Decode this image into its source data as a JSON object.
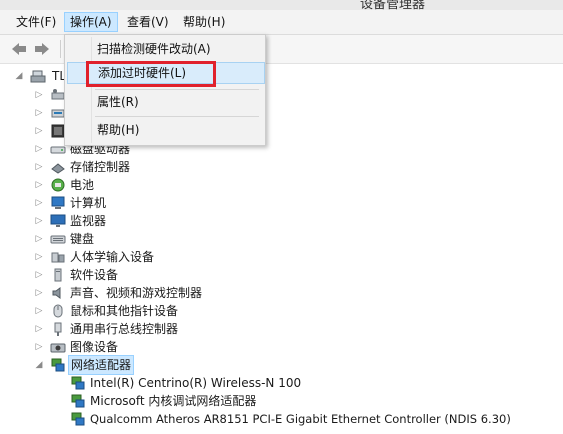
{
  "window": {
    "title": "设备管理器"
  },
  "menubar": {
    "items": [
      {
        "label": "文件(F)"
      },
      {
        "label": "操作(A)"
      },
      {
        "label": "查看(V)"
      },
      {
        "label": "帮助(H)"
      }
    ]
  },
  "toolbar": {
    "back_icon": "back-arrow-icon",
    "forward_icon": "forward-arrow-icon"
  },
  "action_menu": {
    "items": [
      {
        "label": "扫描检测硬件改动(A)"
      },
      {
        "label": "添加过时硬件(L)"
      },
      {
        "label": "属性(R)"
      },
      {
        "label": "帮助(H)"
      }
    ],
    "highlighted_item": "添加过时硬件(L)",
    "highlight_color": "#e0212c"
  },
  "tree": {
    "root": {
      "label": "TL"
    },
    "categories": [
      {
        "label": "磁盘驱动器",
        "icon": "disk-drive-icon"
      },
      {
        "label": "存储控制器",
        "icon": "storage-controller-icon"
      },
      {
        "label": "电池",
        "icon": "battery-icon"
      },
      {
        "label": "计算机",
        "icon": "computer-icon"
      },
      {
        "label": "监视器",
        "icon": "monitor-icon"
      },
      {
        "label": "键盘",
        "icon": "keyboard-icon"
      },
      {
        "label": "人体学输入设备",
        "icon": "hid-icon"
      },
      {
        "label": "软件设备",
        "icon": "software-device-icon"
      },
      {
        "label": "声音、视频和游戏控制器",
        "icon": "sound-icon"
      },
      {
        "label": "鼠标和其他指针设备",
        "icon": "mouse-icon"
      },
      {
        "label": "通用串行总线控制器",
        "icon": "usb-icon"
      },
      {
        "label": "图像设备",
        "icon": "camera-icon"
      },
      {
        "label": "网络适配器",
        "icon": "network-adapter-icon"
      }
    ],
    "network_children": [
      {
        "label": "Intel(R) Centrino(R) Wireless-N 100"
      },
      {
        "label": "Microsoft 内核调试网络适配器"
      },
      {
        "label": "Qualcomm Atheros AR8151 PCI-E Gigabit Ethernet Controller (NDIS 6.30)"
      }
    ],
    "selection_color": "#cce8ff"
  }
}
